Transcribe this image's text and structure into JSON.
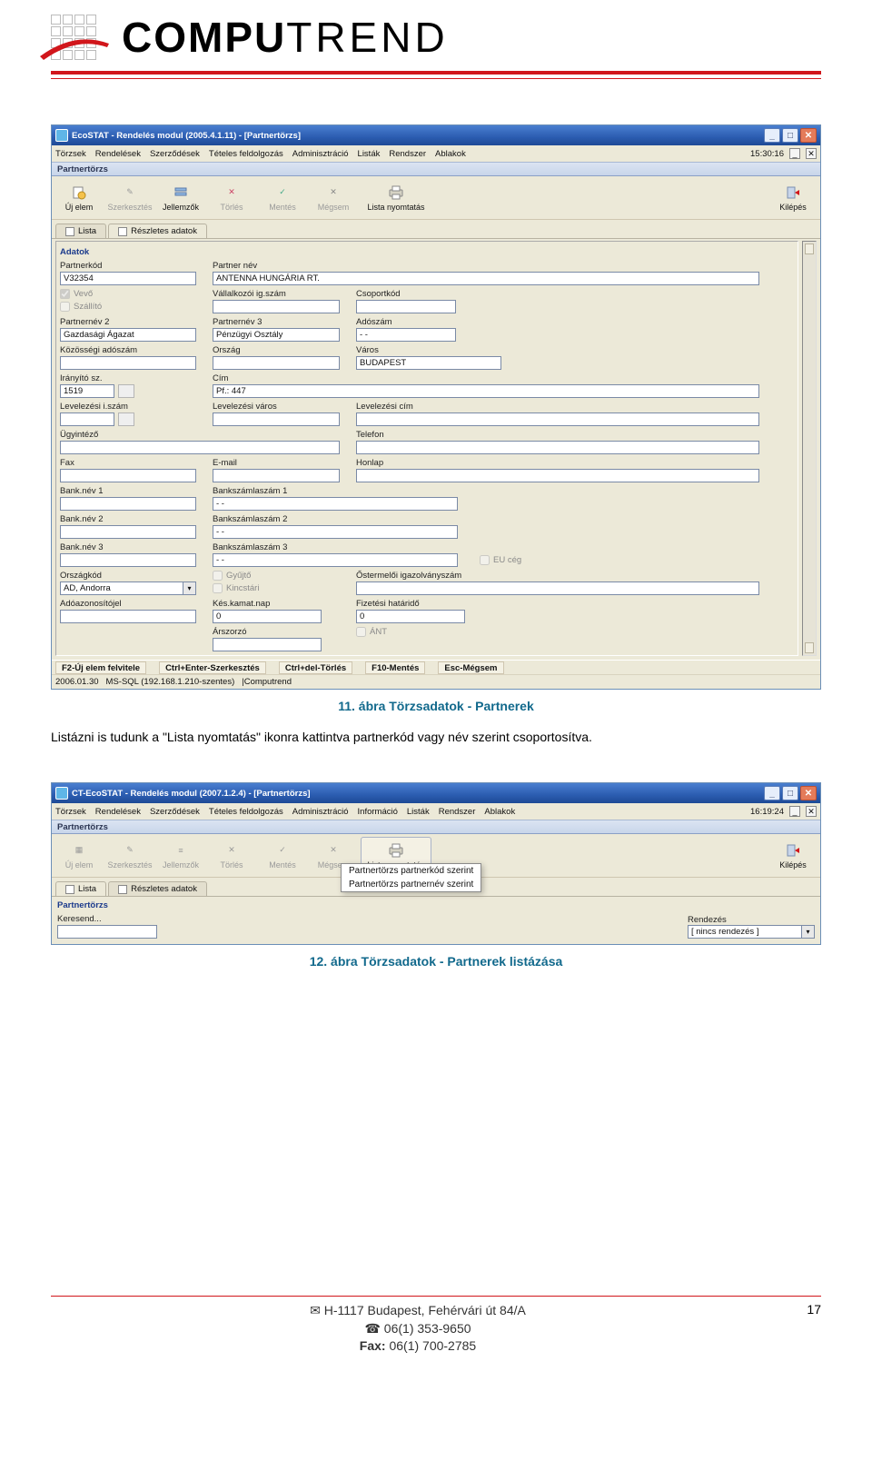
{
  "brand_text_left": "COMPU",
  "brand_text_right": "TREND",
  "caption1": "11. ábra Törzsadatok - Partnerek",
  "body_text": "Listázni is tudunk a \"Lista nyomtatás\" ikonra kattintva partnerkód vagy név szerint csoportosítva.",
  "caption2": "12. ábra Törzsadatok - Partnerek listázása",
  "shot1": {
    "title": "EcoSTAT - Rendelés modul (2005.4.1.11) - [Partnertörzs]",
    "menus": [
      "Törzsek",
      "Rendelések",
      "Szerződések",
      "Tételes feldolgozás",
      "Adminisztráció",
      "Listák",
      "Rendszer",
      "Ablakok"
    ],
    "time": "15:30:16",
    "subtitle": "Partnertörzs",
    "tb": {
      "ujelem": "Új elem",
      "szerkesztes": "Szerkesztés",
      "jellemzok": "Jellemzők",
      "torles": "Törlés",
      "mentes": "Mentés",
      "megsem": "Mégsem",
      "listany": "Lista nyomtatás",
      "kilepes": "Kilépés"
    },
    "tabs": {
      "lista": "Lista",
      "reszl": "Részletes adatok"
    },
    "section": "Adatok",
    "labels": {
      "partnerkod": "Partnerkód",
      "partnernev": "Partner név",
      "vevo": "Vevő",
      "szallito": "Szállító",
      "vall_ig": "Vállalkozói ig.szám",
      "csoportkod": "Csoportkód",
      "partnernev2": "Partnernév 2",
      "partnernev3": "Partnernév 3",
      "adoszam": "Adószám",
      "koz_adoszam": "Közösségi adószám",
      "orszag": "Ország",
      "varos": "Város",
      "iranyito": "Irányító sz.",
      "cim": "Cím",
      "lev_iszam": "Levelezési i.szám",
      "lev_varos": "Levelezési város",
      "lev_cim": "Levelezési cím",
      "ugyintezo": "Ügyintéző",
      "telefon": "Telefon",
      "fax": "Fax",
      "email": "E-mail",
      "honlap": "Honlap",
      "banknev1": "Bank.név 1",
      "bankszla1": "Bankszámlaszám 1",
      "banknev2": "Bank.név 2",
      "bankszla2": "Bankszámlaszám 2",
      "banknev3": "Bank.név 3",
      "bankszla3": "Bankszámlaszám 3",
      "eu": "EU cég",
      "orszagkod": "Országkód",
      "gyujto": "Gyűjtő",
      "ostermelo": "Őstermelői igazolványszám",
      "kincstari": "Kincstári",
      "adoazon": "Adóazonosítójel",
      "kesnap": "Kés.kamat.nap",
      "fizhat": "Fizetési határidő",
      "arszorzo": "Árszorzó",
      "ant": "ÁNT"
    },
    "values": {
      "partnerkod": "V32354",
      "partnernev": "ANTENNA HUNGÁRIA RT.",
      "partnernev2": "Gazdasági Ágazat",
      "partnernev3": "Pénzügyi Osztály",
      "adoszam": "- -",
      "varos": "BUDAPEST",
      "iranyito": "1519",
      "cim": "Pf.: 447",
      "bankszla_parts": "-   -",
      "orszagkod": "AD, Andorra",
      "kesnap": "0",
      "fizhat": "0"
    },
    "status": {
      "f2": "F2-Új elem felvitele",
      "ctrlenter": "Ctrl+Enter-Szerkesztés",
      "ctrldel": "Ctrl+del-Törlés",
      "f10": "F10-Mentés",
      "esc": "Esc-Mégsem"
    },
    "status2": {
      "date": "2006.01.30",
      "db": "MS-SQL (192.168.1.210-szentes)",
      "user": "|Computrend"
    }
  },
  "shot2": {
    "title": "CT-EcoSTAT - Rendelés modul (2007.1.2.4) - [Partnertörzs]",
    "menus": [
      "Törzsek",
      "Rendelések",
      "Szerződések",
      "Tételes feldolgozás",
      "Adminisztráció",
      "Információ",
      "Listák",
      "Rendszer",
      "Ablakok"
    ],
    "time": "16:19:24",
    "subtitle": "Partnertörzs",
    "tb": {
      "ujelem": "Új elem",
      "szerkesztes": "Szerkesztés",
      "jellemzok": "Jellemzők",
      "torles": "Törlés",
      "mentes": "Mentés",
      "megsem": "Mégsem",
      "listany": "Lista nyomtatás",
      "kilepes": "Kilépés"
    },
    "tabs": {
      "lista": "Lista",
      "reszl": "Részletes adatok"
    },
    "dropdown": {
      "opt1": "Partnertörzs partnerkód szerint",
      "opt2": "Partnertörzs partnernév szerint"
    },
    "listhead": "Partnertörzs",
    "rendezes_label": "Rendezés",
    "rendezes_val": "[ nincs rendezés ]",
    "keresend": "Keresend..."
  },
  "footer": {
    "addr": "H-1117 Budapest, Fehérvári út 84/A",
    "tel": "06(1) 353-9650",
    "fax_label": "Fax:",
    "fax": "06(1) 700-2785",
    "page": "17"
  }
}
